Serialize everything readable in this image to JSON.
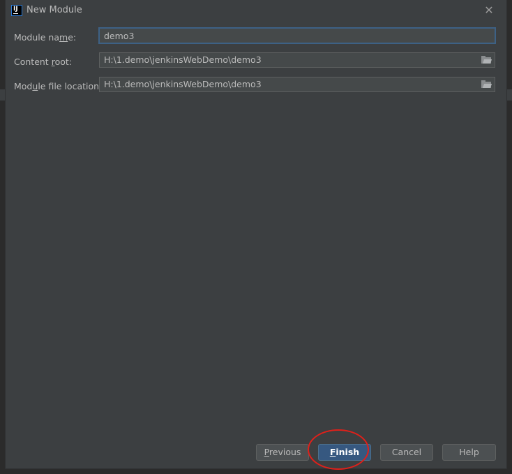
{
  "dialog": {
    "title": "New Module",
    "close_glyph": "✕"
  },
  "fields": {
    "module_name": {
      "label_pre": "Module na",
      "label_mn": "m",
      "label_post": "e:",
      "value": "demo3"
    },
    "content_root": {
      "label_pre": "Content ",
      "label_mn": "r",
      "label_post": "oot:",
      "value": "H:\\1.demo\\jenkinsWebDemo\\demo3"
    },
    "module_file_location": {
      "label_pre": "Mod",
      "label_mn": "u",
      "label_post": "le file location:",
      "value": "H:\\1.demo\\jenkinsWebDemo\\demo3"
    }
  },
  "buttons": {
    "previous": {
      "mn": "P",
      "rest": "revious"
    },
    "finish": {
      "mn": "F",
      "rest": "inish"
    },
    "cancel": "Cancel",
    "help": "Help"
  },
  "icons": {
    "app": "intellij-idea-icon",
    "close": "close-icon",
    "folder": "folder-icon"
  },
  "colors": {
    "dialog_bg": "#3c3f41",
    "field_bg": "#45494a",
    "default_button": "#365880",
    "focus_border": "#3d6185",
    "annotation": "#e0201a"
  }
}
